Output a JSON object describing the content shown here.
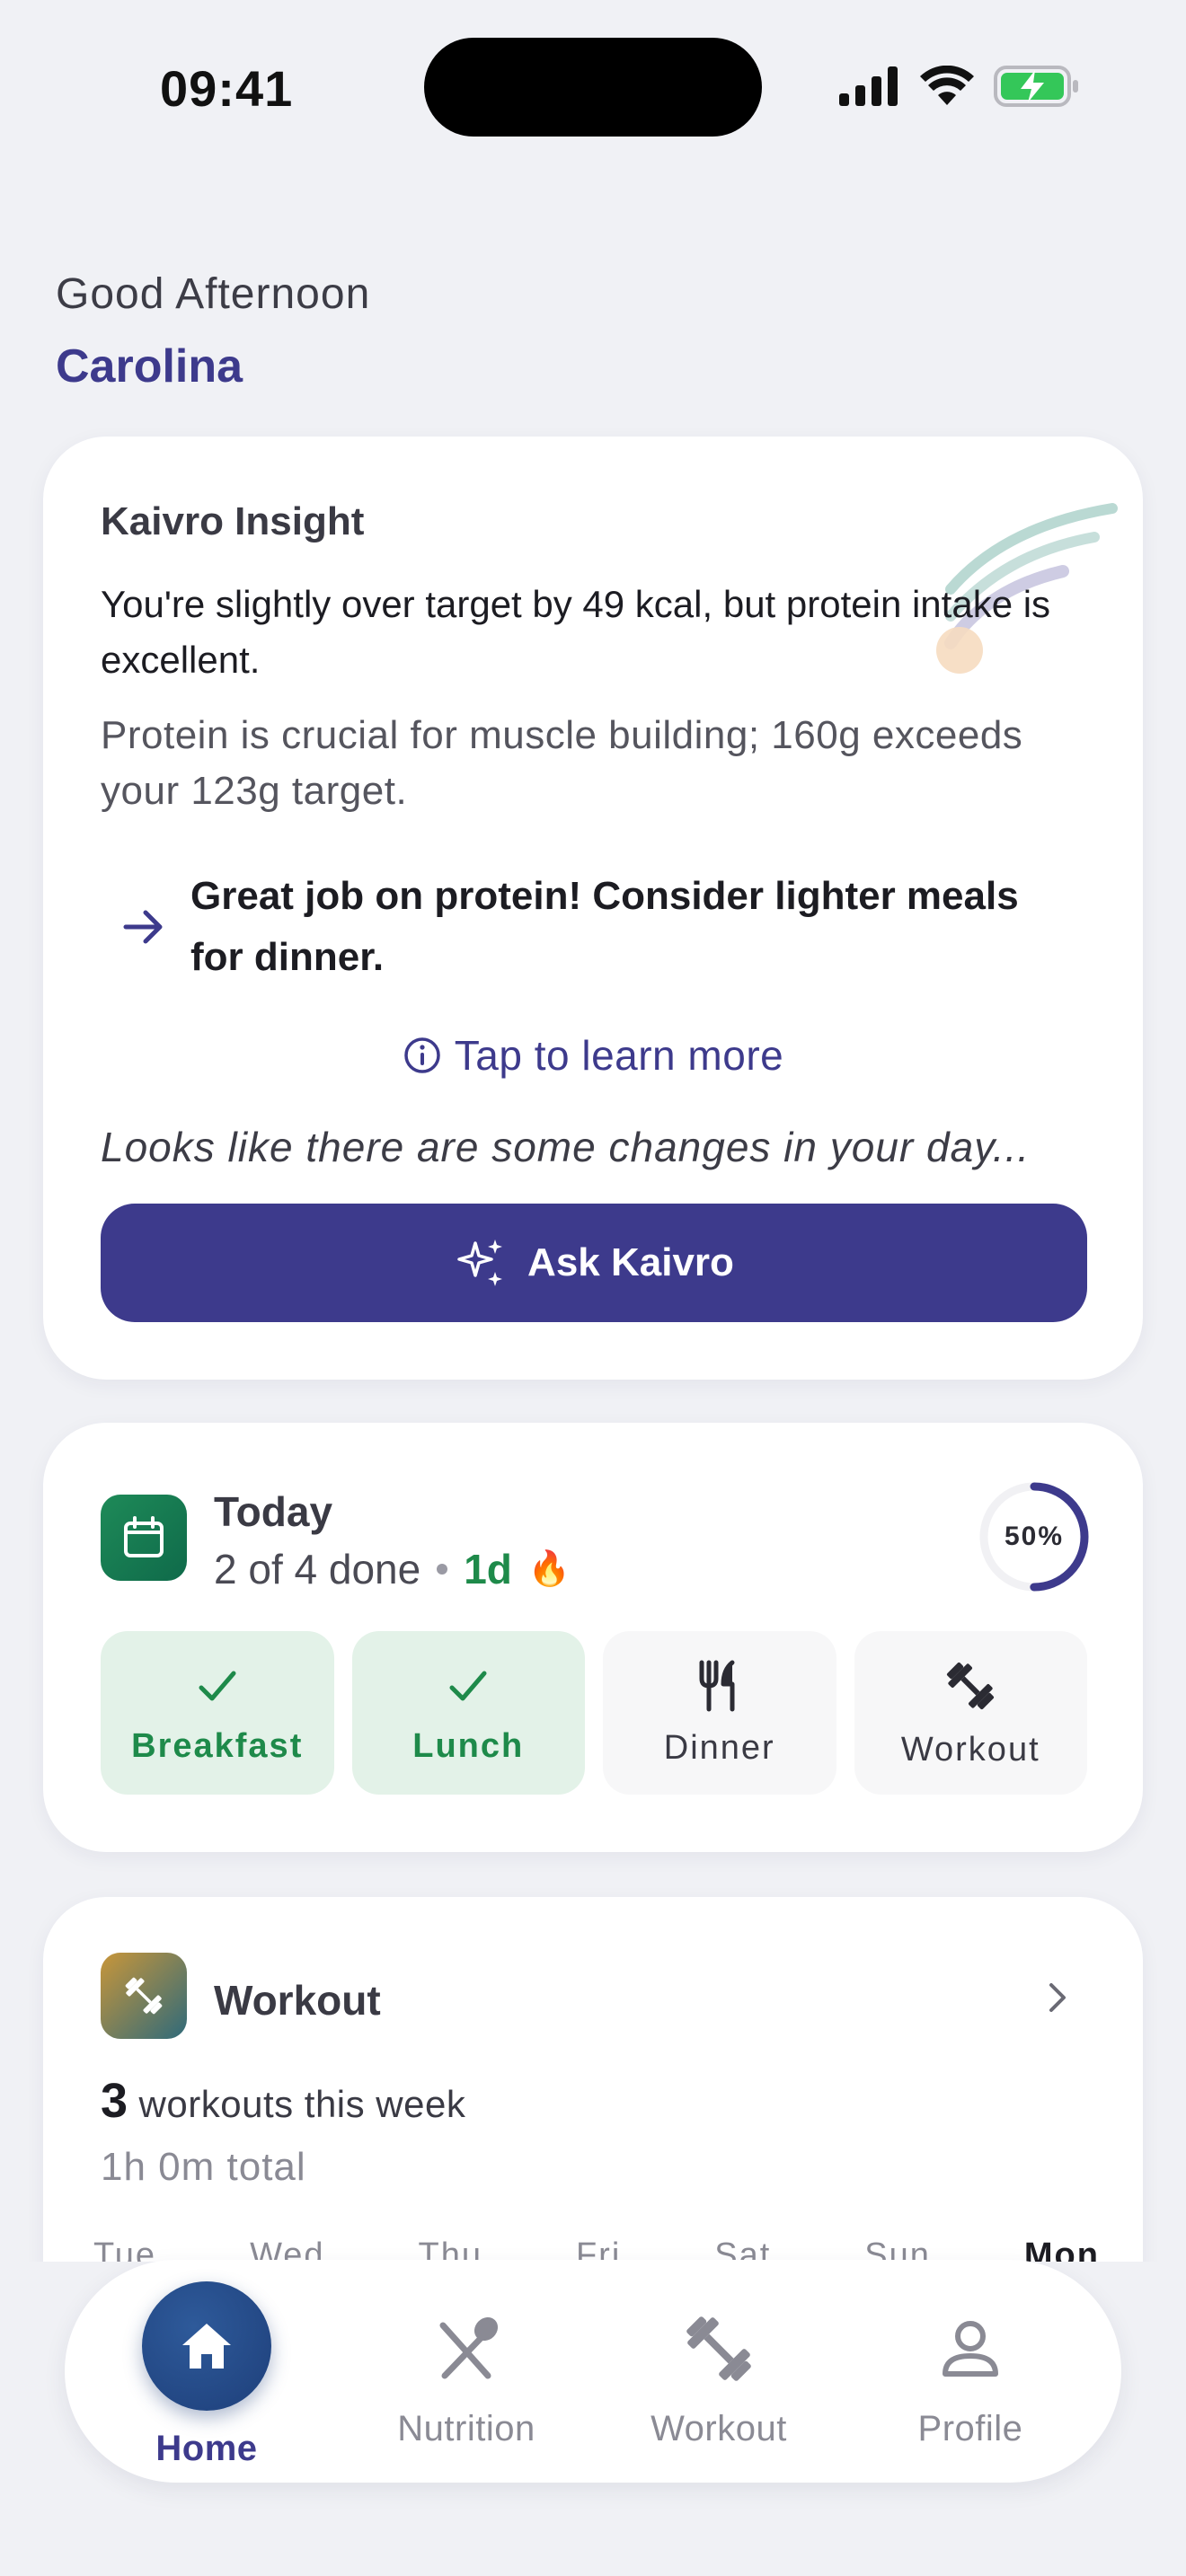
{
  "status_bar": {
    "time": "09:41"
  },
  "greeting": {
    "salutation": "Good Afternoon",
    "name": "Carolina"
  },
  "insight": {
    "title": "Kaivro Insight",
    "headline": "You're slightly over target by 49 kcal, but protein intake is excellent.",
    "detail": "Protein is crucial for muscle building; 160g exceeds your 123g target.",
    "tip": "Great job on protein! Consider lighter meals for dinner.",
    "learn_more": "Tap to learn more",
    "changes_prompt": "Looks like there are some changes in your day...",
    "ask_button": "Ask Kaivro"
  },
  "today": {
    "title": "Today",
    "done_text": "2 of 4 done",
    "streak": "1d",
    "streak_icon": "🔥",
    "progress_label": "50%",
    "progress_fraction": 0.5,
    "tasks": [
      {
        "label": "Breakfast",
        "done": true,
        "icon": "check-icon"
      },
      {
        "label": "Lunch",
        "done": true,
        "icon": "check-icon"
      },
      {
        "label": "Dinner",
        "done": false,
        "icon": "fork-knife-icon"
      },
      {
        "label": "Workout",
        "done": false,
        "icon": "dumbbell-icon"
      }
    ]
  },
  "workout": {
    "title": "Workout",
    "count": "3",
    "count_label": "workouts this week",
    "total": "1h 0m total",
    "days": [
      "Tue",
      "Wed",
      "Thu",
      "Fri",
      "Sat",
      "Sun",
      "Mon"
    ]
  },
  "tab_bar": {
    "tabs": [
      {
        "label": "Home",
        "icon": "home-icon",
        "active": true
      },
      {
        "label": "Nutrition",
        "icon": "spoon-knife-icon",
        "active": false
      },
      {
        "label": "Workout",
        "icon": "dumbbell-icon",
        "active": false
      },
      {
        "label": "Profile",
        "icon": "person-icon",
        "active": false
      }
    ]
  },
  "colors": {
    "accent": "#3d3a8c",
    "success": "#1e8a4a",
    "success_bg": "#e3f2e8",
    "background": "#f0f1f5"
  }
}
